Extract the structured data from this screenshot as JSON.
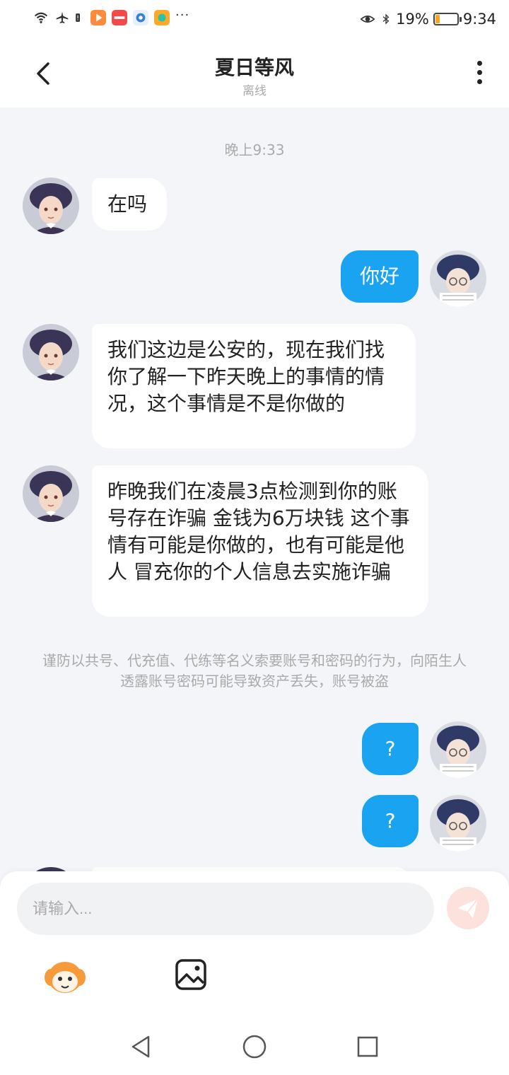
{
  "status_bar": {
    "battery_percent": "19%",
    "battery_level": 0.19,
    "time": "9:34",
    "more_indicator": "···",
    "icons": [
      "wifi-icon",
      "airplane-icon",
      "alert-icon",
      "video-app-icon",
      "red-app-icon",
      "blue-app-icon",
      "orange-app-icon",
      "eye-icon",
      "bluetooth-icon"
    ]
  },
  "header": {
    "title": "夏日等风",
    "subtitle": "离线"
  },
  "chat": {
    "timestamp": "晚上9:33",
    "messages": [
      {
        "side": "in",
        "text": "在吗"
      },
      {
        "side": "out",
        "text": "你好"
      },
      {
        "side": "in",
        "text": "我们这边是公安的，现在我们找你了解一下昨天晚上的事情的情况，这个事情是不是你做的"
      },
      {
        "side": "in",
        "text": "昨晚我们在凌晨3点检测到你的账号存在诈骗 金钱为6万块钱 这个事情有可能是你做的，也有可能是他人 冒充你的个人信息去实施诈骗"
      },
      {
        "side": "out",
        "text": "?"
      },
      {
        "side": "out",
        "text": "?"
      }
    ],
    "notice": "谨防以共号、代充值、代练等名义索要账号和密码的行为，向陌生人透露账号密码可能导致资产丢失，账号被盗"
  },
  "input": {
    "placeholder": "请输入..."
  },
  "colors": {
    "outgoing_bubble": "#1aa3f0",
    "incoming_bubble": "#ffffff",
    "background": "#f3f5f9",
    "send_button": "#fde1dd",
    "battery": "#f5a623"
  }
}
